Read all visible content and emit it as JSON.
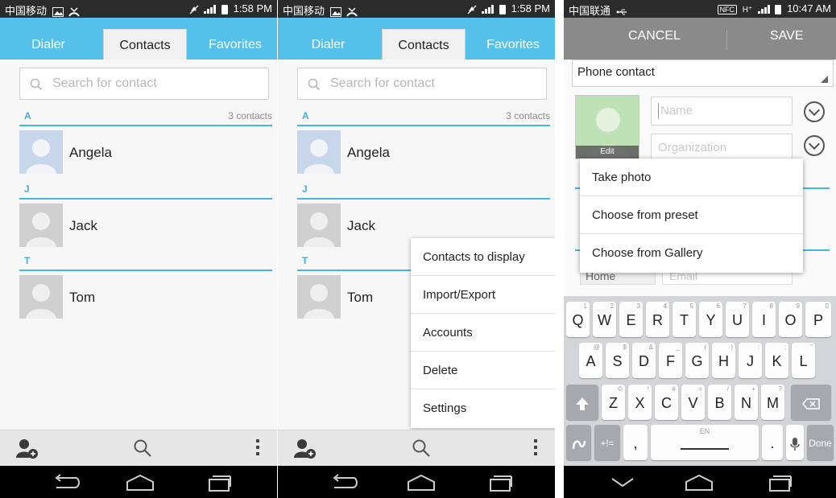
{
  "phones": [
    {
      "status": {
        "carrier": "中国移动",
        "time": "1:58 PM"
      },
      "tabs": [
        {
          "label": "Dialer"
        },
        {
          "label": "Contacts"
        },
        {
          "label": "Favorites"
        }
      ],
      "search_placeholder": "Search for contact",
      "sections": [
        {
          "letter": "A",
          "count": "3 contacts",
          "contacts": [
            "Angela"
          ]
        },
        {
          "letter": "J",
          "contacts": [
            "Jack"
          ]
        },
        {
          "letter": "T",
          "contacts": [
            "Tom"
          ]
        }
      ]
    },
    {
      "status": {
        "carrier": "中国移动",
        "time": "1:58 PM"
      },
      "tabs": [
        {
          "label": "Dialer"
        },
        {
          "label": "Contacts"
        },
        {
          "label": "Favorites"
        }
      ],
      "search_placeholder": "Search for contact",
      "sections": [
        {
          "letter": "A",
          "count": "3 contacts",
          "contacts": [
            "Angela"
          ]
        },
        {
          "letter": "J",
          "contacts": [
            "Jack"
          ]
        },
        {
          "letter": "T",
          "contacts": [
            "Tom"
          ]
        }
      ],
      "menu": [
        "Contacts to display",
        "Import/Export",
        "Accounts",
        "Delete",
        "Settings"
      ]
    },
    {
      "status": {
        "carrier": "中国联通",
        "badge": "NFC",
        "network": "H⁺",
        "time": "10:47 AM"
      },
      "cancel_label": "CANCEL",
      "save_label": "SAVE",
      "account_type": "Phone contact",
      "photo_edit_label": "Edit",
      "name_placeholder": "Name",
      "organization_placeholder": "Organization",
      "popup": [
        "Take photo",
        "Choose from preset",
        "Choose from Gallery"
      ],
      "label_home": "Home",
      "email_placeholder": "Email",
      "keyboard": {
        "row1": [
          [
            "Q",
            "1"
          ],
          [
            "W",
            "2"
          ],
          [
            "E",
            "3"
          ],
          [
            "R",
            "4"
          ],
          [
            "T",
            "5"
          ],
          [
            "Y",
            "6"
          ],
          [
            "U",
            "7"
          ],
          [
            "I",
            "8"
          ],
          [
            "O",
            "9"
          ],
          [
            "P",
            "0"
          ]
        ],
        "row2": [
          [
            "A",
            "@"
          ],
          [
            "S",
            "$"
          ],
          [
            "D",
            "&"
          ],
          [
            "F",
            "_"
          ],
          [
            "G",
            "("
          ],
          [
            "H",
            ")"
          ],
          [
            "J",
            ":"
          ],
          [
            "K",
            ";"
          ],
          [
            "L",
            "\""
          ]
        ],
        "row3": [
          [
            "Z",
            "©"
          ],
          [
            "X",
            "!"
          ],
          [
            "C",
            "#"
          ],
          [
            "V",
            "="
          ],
          [
            "B",
            "/"
          ],
          [
            "N",
            "+"
          ],
          [
            "M",
            "?"
          ]
        ],
        "symbols": "+!=",
        "comma": ",",
        "space_label": "EN",
        "period": ".",
        "done_label": "Done"
      }
    }
  ],
  "colors": {
    "tab_bar": "#55c1ea",
    "accent": "#45b5e2",
    "status_bar": "#2b2b2b",
    "nav_bar": "#000000"
  }
}
